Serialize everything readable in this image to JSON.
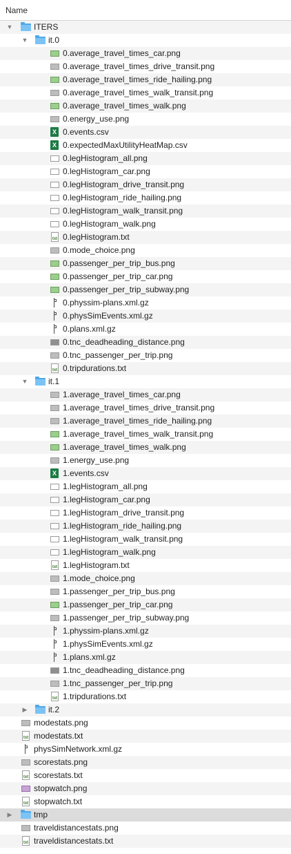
{
  "header": {
    "column_name": "Name"
  },
  "tree": [
    {
      "name": "ITERS",
      "type": "folder",
      "level": 0,
      "expanded": true
    },
    {
      "name": "it.0",
      "type": "folder",
      "level": 1,
      "expanded": true
    },
    {
      "name": "0.average_travel_times_car.png",
      "type": "png",
      "icon": "green",
      "level": 2
    },
    {
      "name": "0.average_travel_times_drive_transit.png",
      "type": "png",
      "icon": "gray",
      "level": 2
    },
    {
      "name": "0.average_travel_times_ride_hailing.png",
      "type": "png",
      "icon": "green",
      "level": 2
    },
    {
      "name": "0.average_travel_times_walk_transit.png",
      "type": "png",
      "icon": "gray",
      "level": 2
    },
    {
      "name": "0.average_travel_times_walk.png",
      "type": "png",
      "icon": "green",
      "level": 2
    },
    {
      "name": "0.energy_use.png",
      "type": "png",
      "icon": "gray",
      "level": 2
    },
    {
      "name": "0.events.csv",
      "type": "csv",
      "level": 2
    },
    {
      "name": "0.expectedMaxUtilityHeatMap.csv",
      "type": "csv",
      "level": 2
    },
    {
      "name": "0.legHistogram_all.png",
      "type": "png",
      "icon": "white",
      "level": 2
    },
    {
      "name": "0.legHistogram_car.png",
      "type": "png",
      "icon": "white",
      "level": 2
    },
    {
      "name": "0.legHistogram_drive_transit.png",
      "type": "png",
      "icon": "white",
      "level": 2
    },
    {
      "name": "0.legHistogram_ride_hailing.png",
      "type": "png",
      "icon": "white",
      "level": 2
    },
    {
      "name": "0.legHistogram_walk_transit.png",
      "type": "png",
      "icon": "white",
      "level": 2
    },
    {
      "name": "0.legHistogram_walk.png",
      "type": "png",
      "icon": "white",
      "level": 2
    },
    {
      "name": "0.legHistogram.txt",
      "type": "txt",
      "level": 2
    },
    {
      "name": "0.mode_choice.png",
      "type": "png",
      "icon": "gray",
      "level": 2
    },
    {
      "name": "0.passenger_per_trip_bus.png",
      "type": "png",
      "icon": "green",
      "level": 2
    },
    {
      "name": "0.passenger_per_trip_car.png",
      "type": "png",
      "icon": "green",
      "level": 2
    },
    {
      "name": "0.passenger_per_trip_subway.png",
      "type": "png",
      "icon": "green",
      "level": 2
    },
    {
      "name": "0.physsim-plans.xml.gz",
      "type": "gz",
      "level": 2
    },
    {
      "name": "0.physSimEvents.xml.gz",
      "type": "gz",
      "level": 2
    },
    {
      "name": "0.plans.xml.gz",
      "type": "gz",
      "level": 2
    },
    {
      "name": "0.tnc_deadheading_distance.png",
      "type": "png",
      "icon": "dark",
      "level": 2
    },
    {
      "name": "0.tnc_passenger_per_trip.png",
      "type": "png",
      "icon": "gray",
      "level": 2
    },
    {
      "name": "0.tripdurations.txt",
      "type": "txt",
      "level": 2
    },
    {
      "name": "it.1",
      "type": "folder",
      "level": 1,
      "expanded": true
    },
    {
      "name": "1.average_travel_times_car.png",
      "type": "png",
      "icon": "gray",
      "level": 2
    },
    {
      "name": "1.average_travel_times_drive_transit.png",
      "type": "png",
      "icon": "gray",
      "level": 2
    },
    {
      "name": "1.average_travel_times_ride_hailing.png",
      "type": "png",
      "icon": "gray",
      "level": 2
    },
    {
      "name": "1.average_travel_times_walk_transit.png",
      "type": "png",
      "icon": "green",
      "level": 2
    },
    {
      "name": "1.average_travel_times_walk.png",
      "type": "png",
      "icon": "green",
      "level": 2
    },
    {
      "name": "1.energy_use.png",
      "type": "png",
      "icon": "gray",
      "level": 2
    },
    {
      "name": "1.events.csv",
      "type": "csv",
      "level": 2
    },
    {
      "name": "1.legHistogram_all.png",
      "type": "png",
      "icon": "white",
      "level": 2
    },
    {
      "name": "1.legHistogram_car.png",
      "type": "png",
      "icon": "white",
      "level": 2
    },
    {
      "name": "1.legHistogram_drive_transit.png",
      "type": "png",
      "icon": "white",
      "level": 2
    },
    {
      "name": "1.legHistogram_ride_hailing.png",
      "type": "png",
      "icon": "white",
      "level": 2
    },
    {
      "name": "1.legHistogram_walk_transit.png",
      "type": "png",
      "icon": "white",
      "level": 2
    },
    {
      "name": "1.legHistogram_walk.png",
      "type": "png",
      "icon": "white",
      "level": 2
    },
    {
      "name": "1.legHistogram.txt",
      "type": "txt",
      "level": 2
    },
    {
      "name": "1.mode_choice.png",
      "type": "png",
      "icon": "gray",
      "level": 2
    },
    {
      "name": "1.passenger_per_trip_bus.png",
      "type": "png",
      "icon": "gray",
      "level": 2
    },
    {
      "name": "1.passenger_per_trip_car.png",
      "type": "png",
      "icon": "green",
      "level": 2
    },
    {
      "name": "1.passenger_per_trip_subway.png",
      "type": "png",
      "icon": "gray",
      "level": 2
    },
    {
      "name": "1.physsim-plans.xml.gz",
      "type": "gz",
      "level": 2
    },
    {
      "name": "1.physSimEvents.xml.gz",
      "type": "gz",
      "level": 2
    },
    {
      "name": "1.plans.xml.gz",
      "type": "gz",
      "level": 2
    },
    {
      "name": "1.tnc_deadheading_distance.png",
      "type": "png",
      "icon": "dark",
      "level": 2
    },
    {
      "name": "1.tnc_passenger_per_trip.png",
      "type": "png",
      "icon": "gray",
      "level": 2
    },
    {
      "name": "1.tripdurations.txt",
      "type": "txt",
      "level": 2
    },
    {
      "name": "it.2",
      "type": "folder",
      "level": 1,
      "expanded": false
    },
    {
      "name": "modestats.png",
      "type": "png",
      "icon": "gray",
      "level": 0
    },
    {
      "name": "modestats.txt",
      "type": "txt",
      "level": 0
    },
    {
      "name": "physSimNetwork.xml.gz",
      "type": "gz",
      "level": 0
    },
    {
      "name": "scorestats.png",
      "type": "png",
      "icon": "gray",
      "level": 0
    },
    {
      "name": "scorestats.txt",
      "type": "txt",
      "level": 0
    },
    {
      "name": "stopwatch.png",
      "type": "png",
      "icon": "purple",
      "level": 0
    },
    {
      "name": "stopwatch.txt",
      "type": "txt",
      "level": 0
    },
    {
      "name": "tmp",
      "type": "folder",
      "level": -1,
      "expanded": false,
      "selected": true
    },
    {
      "name": "traveldistancestats.png",
      "type": "png",
      "icon": "gray",
      "level": 0
    },
    {
      "name": "traveldistancestats.txt",
      "type": "txt",
      "level": 0
    }
  ]
}
